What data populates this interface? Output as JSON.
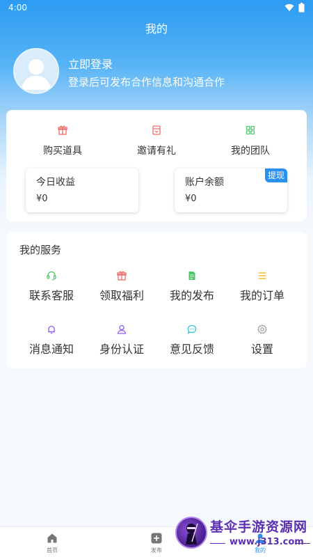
{
  "status": {
    "time": "4:00"
  },
  "page_title": "我的",
  "login": {
    "title": "立即登录",
    "subtitle": "登录后可发布合作信息和沟通合作"
  },
  "quick_actions": [
    {
      "label": "购买道具",
      "icon": "gift-icon"
    },
    {
      "label": "邀请有礼",
      "icon": "invite-icon"
    },
    {
      "label": "我的团队",
      "icon": "grid-icon"
    }
  ],
  "earnings": {
    "title": "今日收益",
    "value": "¥0"
  },
  "balance": {
    "title": "账户余额",
    "value": "¥0",
    "withdraw_label": "提现"
  },
  "services": {
    "title": "我的服务",
    "items": [
      {
        "label": "联系客服",
        "icon": "headset-icon"
      },
      {
        "label": "领取福利",
        "icon": "gift-icon"
      },
      {
        "label": "我的发布",
        "icon": "document-icon"
      },
      {
        "label": "我的订单",
        "icon": "list-icon"
      },
      {
        "label": "消息通知",
        "icon": "bell-icon"
      },
      {
        "label": "身份认证",
        "icon": "user-icon"
      },
      {
        "label": "意见反馈",
        "icon": "chat-icon"
      },
      {
        "label": "设置",
        "icon": "gear-icon"
      }
    ]
  },
  "tabs": [
    {
      "label": "首页",
      "icon": "home-icon"
    },
    {
      "label": "发布",
      "icon": "plus-icon"
    },
    {
      "label": "我的",
      "icon": "user-icon"
    }
  ],
  "watermark": {
    "line1": "基伞手游资源网",
    "line2": "www.j313.com"
  },
  "colors": {
    "accent": "#2b8ff0",
    "red": "#f06a6a",
    "green": "#4cc766",
    "yellow": "#f5b41e",
    "purple": "#8b5cf6",
    "cyan": "#2ec4d6",
    "gray": "#999999"
  }
}
